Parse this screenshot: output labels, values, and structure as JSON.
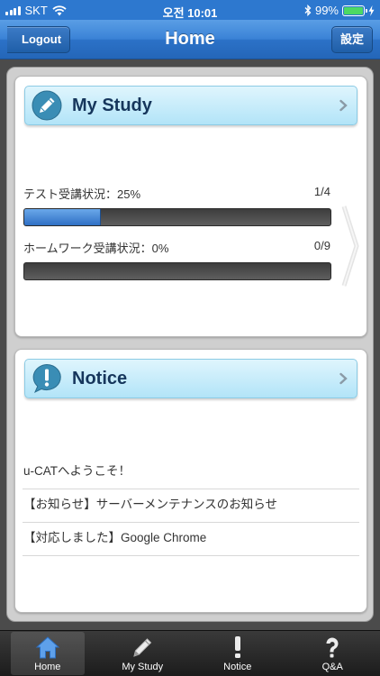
{
  "status_bar": {
    "carrier": "SKT",
    "time": "오전 10:01",
    "battery_percent": "99%",
    "battery_level": 0.99,
    "icons": [
      "signal-icon",
      "wifi-icon",
      "bluetooth-icon",
      "battery-icon",
      "charging-icon"
    ]
  },
  "nav": {
    "title": "Home",
    "back_label": "Logout",
    "settings_label": "設定"
  },
  "study": {
    "title": "My Study",
    "icon": "pencil-icon",
    "test_label": "テスト受講状況：25%",
    "test_count": "1/4",
    "test_progress": 0.25,
    "homework_label": "ホームワーク受講状況：0%",
    "homework_count": "0/9",
    "homework_progress": 0
  },
  "notice": {
    "title": "Notice",
    "icon": "exclamation-bubble-icon",
    "items": [
      "u-CATへようこそ！",
      "【お知らせ】サーバーメンテナンスのお知らせ",
      "【対応しました】Google Chrome"
    ]
  },
  "tabs": [
    {
      "label": "Home",
      "icon": "home-icon",
      "active": true
    },
    {
      "label": "My Study",
      "icon": "pencil-icon",
      "active": false
    },
    {
      "label": "Notice",
      "icon": "exclamation-icon",
      "active": false
    },
    {
      "label": "Q&A",
      "icon": "question-icon",
      "active": false
    }
  ],
  "colors": {
    "nav_blue": "#2d78cf",
    "header_cyan": "#b2e4f8",
    "progress_blue": "#3f84d6",
    "tab_bar": "#1c1c1c"
  }
}
